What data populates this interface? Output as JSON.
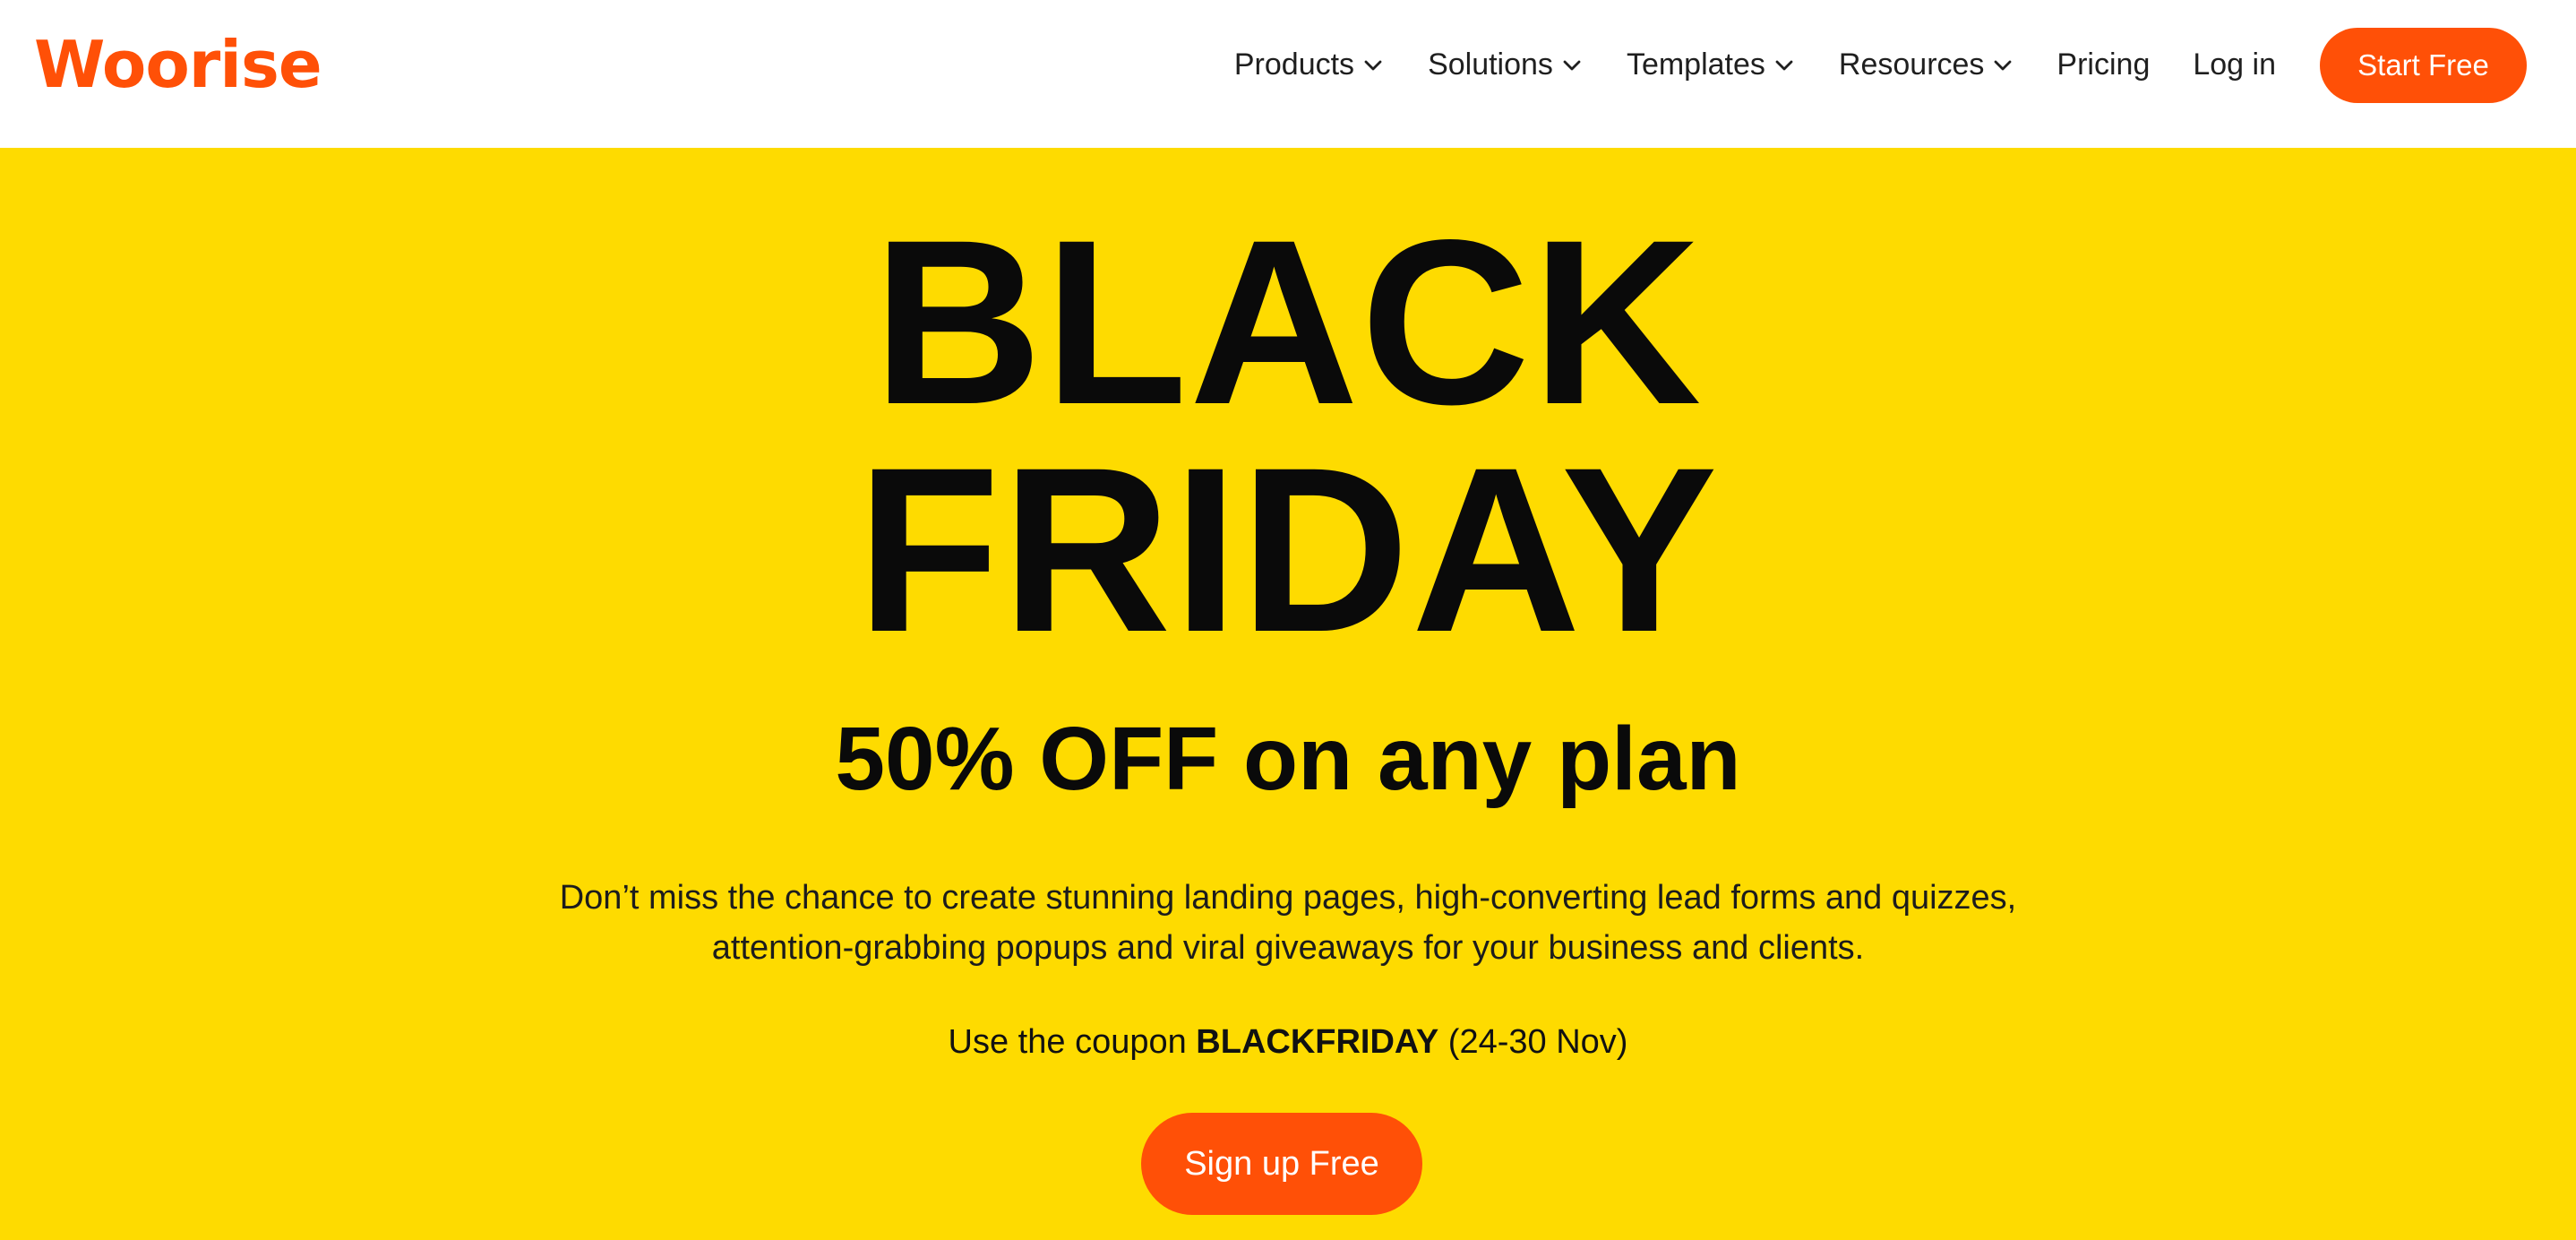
{
  "brand": {
    "logo_text": "Woorise",
    "accent_color": "#ff5007",
    "hero_background": "#fedb00"
  },
  "nav": {
    "items": [
      {
        "label": "Products",
        "icon": "chevron-down-icon"
      },
      {
        "label": "Solutions",
        "icon": "chevron-down-icon"
      },
      {
        "label": "Templates",
        "icon": "chevron-down-icon"
      },
      {
        "label": "Resources",
        "icon": "chevron-down-icon"
      },
      {
        "label": "Pricing"
      },
      {
        "label": "Log in"
      }
    ],
    "cta_label": "Start Free"
  },
  "hero": {
    "headline_line1": "BLACK",
    "headline_line2": "FRIDAY",
    "subheadline": "50% OFF on any plan",
    "description_line1": "Don’t miss the chance to create stunning landing pages, high-converting lead forms and quizzes,",
    "description_line2": "attention-grabbing popups and viral giveaways for your business and clients.",
    "coupon_prefix": "Use the coupon ",
    "coupon_code": "BLACKFRIDAY",
    "coupon_dates": " (24-30 Nov)",
    "cta_label": "Sign up Free"
  }
}
